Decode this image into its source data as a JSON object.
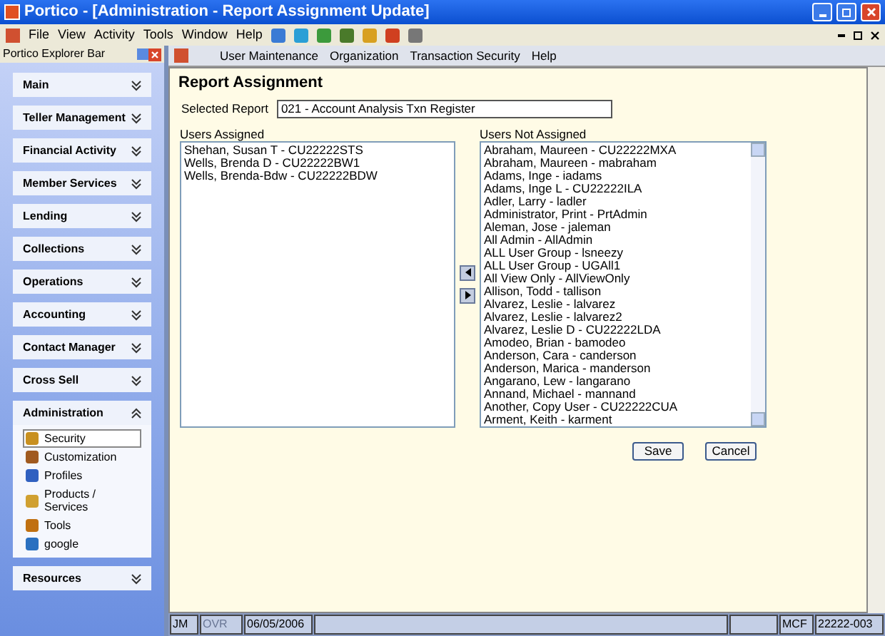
{
  "window": {
    "title": "Portico - [Administration - Report Assignment Update]"
  },
  "menu": [
    "File",
    "View",
    "Activity",
    "Tools",
    "Window",
    "Help"
  ],
  "explorer": {
    "title": "Portico Explorer Bar",
    "groups": [
      {
        "label": "Main",
        "expanded": false
      },
      {
        "label": "Teller Management",
        "expanded": false
      },
      {
        "label": "Financial Activity",
        "expanded": false
      },
      {
        "label": "Member Services",
        "expanded": false
      },
      {
        "label": "Lending",
        "expanded": false
      },
      {
        "label": "Collections",
        "expanded": false
      },
      {
        "label": "Operations",
        "expanded": false
      },
      {
        "label": "Accounting",
        "expanded": false
      },
      {
        "label": "Contact Manager",
        "expanded": false
      },
      {
        "label": "Cross Sell",
        "expanded": false
      },
      {
        "label": "Administration",
        "expanded": true,
        "items": [
          {
            "label": "Security",
            "selected": true
          },
          {
            "label": "Customization",
            "selected": false
          },
          {
            "label": "Profiles",
            "selected": false
          },
          {
            "label": "Products / Services",
            "selected": false
          },
          {
            "label": "Tools",
            "selected": false
          },
          {
            "label": "google",
            "selected": false
          }
        ]
      },
      {
        "label": "Resources",
        "expanded": false
      }
    ]
  },
  "inner_menu": [
    "User Maintenance",
    "Organization",
    "Transaction Security",
    "Help"
  ],
  "form": {
    "heading": "Report Assignment",
    "selected_report_label": "Selected Report",
    "selected_report": "021 - Account Analysis Txn Register",
    "assigned_label": "Users Assigned",
    "assigned": [
      "Shehan, Susan T - CU22222STS",
      "Wells, Brenda D - CU22222BW1",
      "Wells, Brenda-Bdw - CU22222BDW"
    ],
    "not_assigned_label": "Users Not Assigned",
    "not_assigned": [
      "Abraham, Maureen - CU22222MXA",
      "Abraham, Maureen - mabraham",
      "Adams, Inge - iadams",
      "Adams, Inge L - CU22222ILA",
      "Adler, Larry - ladler",
      "Administrator, Print - PrtAdmin",
      "Aleman, Jose - jaleman",
      "All Admin - AllAdmin",
      "ALL User Group - lsneezy",
      "ALL User Group - UGAll1",
      "All View Only - AllViewOnly",
      "Allison, Todd - tallison",
      "Alvarez, Leslie - lalvarez",
      "Alvarez, Leslie - lalvarez2",
      "Alvarez, Leslie D - CU22222LDA",
      "Amodeo, Brian - bamodeo",
      "Anderson, Cara - canderson",
      "Anderson, Marica - manderson",
      "Angarano, Lew - langarano",
      "Annand, Michael - mannand",
      "Another, Copy User - CU22222CUA",
      "Arment, Keith - karment"
    ],
    "buttons": [
      "Save",
      "Cancel"
    ]
  },
  "status_bar": {
    "left": [
      {
        "text": "JM",
        "disabled": false
      },
      {
        "text": "OVR",
        "disabled": true
      },
      {
        "text": "06/05/2006",
        "disabled": false
      }
    ],
    "right": [
      {
        "text": "MCF",
        "disabled": false
      },
      {
        "text": "22222-003",
        "disabled": false
      }
    ]
  }
}
